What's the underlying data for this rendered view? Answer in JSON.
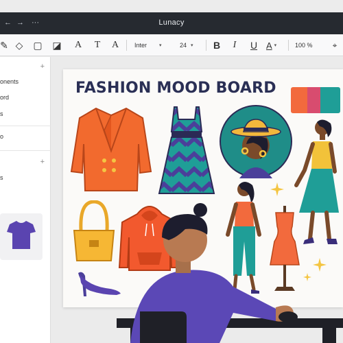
{
  "window": {
    "title": "Lunacy",
    "nav_back": "←",
    "nav_forward": "→",
    "nav_more": "···"
  },
  "toolbar": {
    "tools": [
      {
        "name": "pen-tool-icon",
        "glyph": "✎"
      },
      {
        "name": "fill-tool-icon",
        "glyph": "◇"
      },
      {
        "name": "rectangle-tool-icon",
        "glyph": "▢"
      },
      {
        "name": "image-tool-icon",
        "glyph": "◪"
      },
      {
        "name": "text-tool-icon",
        "glyph": "A"
      },
      {
        "name": "text-style-icon",
        "glyph": "T"
      },
      {
        "name": "text-small-icon",
        "glyph": "A"
      }
    ],
    "font_family": "Inter",
    "font_size": "24",
    "bold": "B",
    "italic": "I",
    "underline": "U",
    "text_color": "A",
    "zoom": "100 %",
    "more": "⌖"
  },
  "left_panel": {
    "items": [
      "onents",
      "ord",
      "s",
      "o",
      "s"
    ],
    "plus": "+"
  },
  "board": {
    "title": "FASHION MOOD BOARD",
    "palette": [
      "#f26a3d",
      "#d84c6f",
      "#1f9e97"
    ]
  }
}
